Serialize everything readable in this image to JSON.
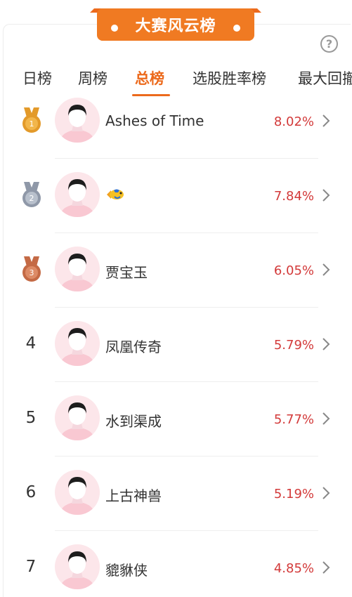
{
  "banner": {
    "title": "大赛风云榜"
  },
  "help": {
    "glyph": "?"
  },
  "tabs": [
    {
      "label": "日榜"
    },
    {
      "label": "周榜"
    },
    {
      "label": "总榜",
      "active": true
    },
    {
      "label": "选股胜率榜"
    },
    {
      "label": "最大回撤"
    }
  ],
  "colors": {
    "accent": "#ec6a1c",
    "percent": "#d33a3a",
    "avatar_bg": "#fce6ea",
    "gold": "#e39a2a",
    "silver": "#8f98a8",
    "bronze": "#c46a45"
  },
  "rows": [
    {
      "rank": "1",
      "medal": "gold-medal-icon",
      "name": "Ashes of Time",
      "percent": "8.02%"
    },
    {
      "rank": "2",
      "medal": "silver-medal-icon",
      "name": "",
      "name_icon": "fish-emoji-icon",
      "percent": "7.84%"
    },
    {
      "rank": "3",
      "medal": "bronze-medal-icon",
      "name": "贾宝玉",
      "percent": "6.05%"
    },
    {
      "rank": "4",
      "name": "凤凰传奇",
      "percent": "5.79%"
    },
    {
      "rank": "5",
      "name": "水到渠成",
      "percent": "5.77%"
    },
    {
      "rank": "6",
      "name": "上古神兽",
      "percent": "5.19%"
    },
    {
      "rank": "7",
      "name": "貔貅侠",
      "percent": "4.85%"
    }
  ]
}
